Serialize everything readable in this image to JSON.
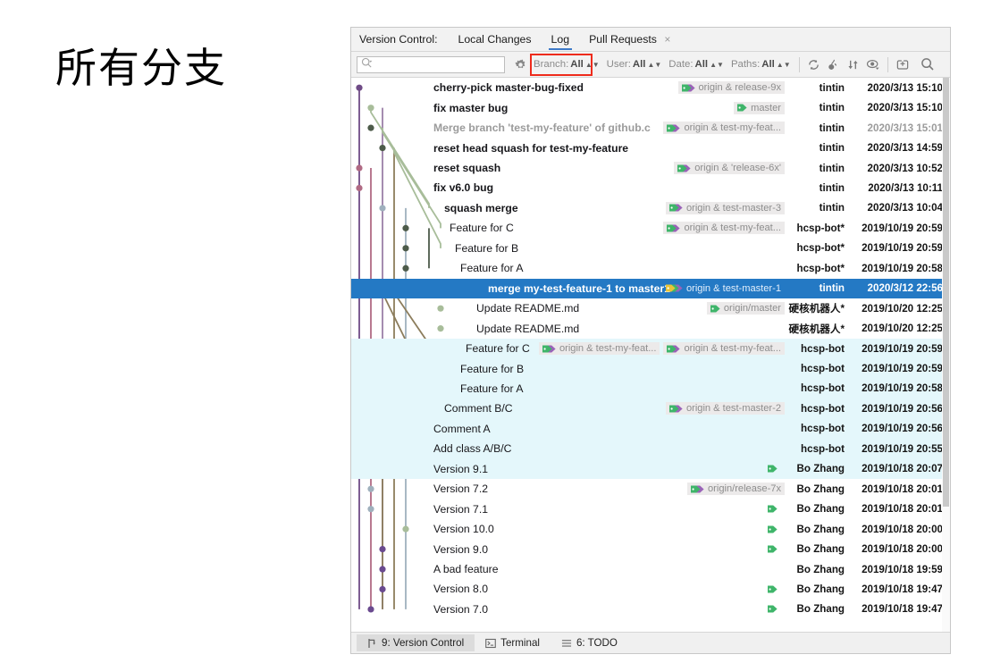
{
  "caption": "所有分支",
  "window": {
    "vc_label": "Version Control:",
    "tabs": [
      {
        "label": "Local Changes",
        "active": false,
        "closable": false
      },
      {
        "label": "Log",
        "active": true,
        "closable": false
      },
      {
        "label": "Pull Requests",
        "active": false,
        "closable": true
      }
    ],
    "close_glyph": "×"
  },
  "toolbar": {
    "search_placeholder": "",
    "search_icon": "search-icon",
    "settings_icon": "gear-icon",
    "filters": [
      {
        "name": "branch",
        "label": "Branch:",
        "value": "All",
        "highlighted": true
      },
      {
        "name": "user",
        "label": "User:",
        "value": "All",
        "highlighted": false
      },
      {
        "name": "date",
        "label": "Date:",
        "value": "All",
        "highlighted": false
      },
      {
        "name": "paths",
        "label": "Paths:",
        "value": "All",
        "highlighted": false
      }
    ],
    "icons": [
      {
        "name": "refresh-icon"
      },
      {
        "name": "cherry-pick-icon"
      },
      {
        "name": "sort-icon"
      },
      {
        "name": "show-details-icon"
      },
      {
        "name": "new-tab-icon"
      },
      {
        "name": "find-icon"
      }
    ],
    "highlight_color": "#ee2b1c"
  },
  "log": {
    "selected_index": 10,
    "band_start": 13,
    "band_end": 19,
    "rows": [
      {
        "subject": "cherry-pick master-bug-fixed",
        "indent": 92,
        "style": "bold",
        "refs": [
          {
            "text": "origin & release-9x",
            "icon": "double-tag-icon"
          }
        ],
        "author": "tintin",
        "date": "2020/3/13 15:10",
        "date_style": "normal"
      },
      {
        "subject": "fix master bug",
        "indent": 92,
        "style": "bold",
        "refs": [
          {
            "text": "master",
            "icon": "tag-icon"
          }
        ],
        "author": "tintin",
        "date": "2020/3/13 15:10",
        "date_style": "normal"
      },
      {
        "subject": "Merge branch 'test-my-feature' of github.c",
        "indent": 92,
        "style": "grey",
        "refs": [
          {
            "text": "origin & test-my-feat...",
            "icon": "double-tag-icon"
          }
        ],
        "author": "tintin",
        "date": "2020/3/13 15:01",
        "date_style": "grey"
      },
      {
        "subject": "reset head squash for test-my-feature",
        "indent": 92,
        "style": "bold",
        "refs": [],
        "author": "tintin",
        "date": "2020/3/13 14:59",
        "date_style": "normal"
      },
      {
        "subject": "reset squash",
        "indent": 92,
        "style": "bold",
        "refs": [
          {
            "text": "origin & 'release-6x'",
            "icon": "double-tag-icon"
          }
        ],
        "author": "tintin",
        "date": "2020/3/13 10:52",
        "date_style": "normal"
      },
      {
        "subject": "fix v6.0 bug",
        "indent": 92,
        "style": "bold",
        "refs": [],
        "author": "tintin",
        "date": "2020/3/13 10:11",
        "date_style": "normal"
      },
      {
        "subject": "squash merge",
        "indent": 104,
        "style": "bold",
        "refs": [
          {
            "text": "origin & test-master-3",
            "icon": "double-tag-icon"
          }
        ],
        "author": "tintin",
        "date": "2020/3/13 10:04",
        "date_style": "normal"
      },
      {
        "subject": "Feature for C",
        "indent": 110,
        "style": "normal",
        "refs": [
          {
            "text": "origin & test-my-feat...",
            "icon": "double-tag-icon"
          }
        ],
        "author": "hcsp-bot*",
        "date": "2019/10/19 20:59",
        "date_style": "normal"
      },
      {
        "subject": "Feature for B",
        "indent": 116,
        "style": "normal",
        "refs": [],
        "author": "hcsp-bot*",
        "date": "2019/10/19 20:59",
        "date_style": "normal"
      },
      {
        "subject": "Feature for A",
        "indent": 122,
        "style": "normal",
        "refs": [],
        "author": "hcsp-bot*",
        "date": "2019/10/19 20:58",
        "date_style": "normal"
      },
      {
        "subject": "merge my-test-feature-1 to master1",
        "indent": 153,
        "style": "bold",
        "refs": [
          {
            "text": "origin & test-master-1",
            "icon": "triple-tag-icon"
          }
        ],
        "author": "tintin",
        "date": "2020/3/12 22:56",
        "date_style": "normal"
      },
      {
        "subject": "Update README.md",
        "indent": 140,
        "style": "normal",
        "refs": [
          {
            "text": "origin/master",
            "icon": "tag-icon"
          }
        ],
        "author": "硬核机器人*",
        "date": "2019/10/20 12:25",
        "date_style": "normal"
      },
      {
        "subject": "Update README.md",
        "indent": 140,
        "style": "normal",
        "refs": [],
        "author": "硬核机器人*",
        "date": "2019/10/20 12:25",
        "date_style": "normal"
      },
      {
        "subject": "Feature for C",
        "indent": 128,
        "style": "normal",
        "refs": [
          {
            "text": "origin & test-my-feat...",
            "icon": "double-tag-icon"
          },
          {
            "text": "origin & test-my-feat...",
            "icon": "double-tag-icon"
          }
        ],
        "author": "hcsp-bot",
        "date": "2019/10/19 20:59",
        "date_style": "normal"
      },
      {
        "subject": "Feature for B",
        "indent": 122,
        "style": "normal",
        "refs": [],
        "author": "hcsp-bot",
        "date": "2019/10/19 20:59",
        "date_style": "normal"
      },
      {
        "subject": "Feature for A",
        "indent": 122,
        "style": "normal",
        "refs": [],
        "author": "hcsp-bot",
        "date": "2019/10/19 20:58",
        "date_style": "normal"
      },
      {
        "subject": "Comment B/C",
        "indent": 104,
        "style": "normal",
        "refs": [
          {
            "text": "origin & test-master-2",
            "icon": "double-tag-icon"
          }
        ],
        "author": "hcsp-bot",
        "date": "2019/10/19 20:56",
        "date_style": "normal"
      },
      {
        "subject": "Comment A",
        "indent": 92,
        "style": "normal",
        "refs": [],
        "author": "hcsp-bot",
        "date": "2019/10/19 20:56",
        "date_style": "normal"
      },
      {
        "subject": "Add class A/B/C",
        "indent": 92,
        "style": "normal",
        "refs": [],
        "author": "hcsp-bot",
        "date": "2019/10/19 20:55",
        "date_style": "normal"
      },
      {
        "subject": "Version 9.1",
        "indent": 92,
        "style": "normal",
        "refs": [
          {
            "text": "",
            "icon": "tag-icon"
          }
        ],
        "author": "Bo Zhang",
        "date": "2019/10/18 20:07",
        "date_style": "normal"
      },
      {
        "subject": "Version 7.2",
        "indent": 92,
        "style": "normal",
        "refs": [
          {
            "text": "origin/release-7x",
            "icon": "double-tag-icon"
          }
        ],
        "author": "Bo Zhang",
        "date": "2019/10/18 20:01",
        "date_style": "normal"
      },
      {
        "subject": "Version 7.1",
        "indent": 92,
        "style": "normal",
        "refs": [
          {
            "text": "",
            "icon": "tag-icon"
          }
        ],
        "author": "Bo Zhang",
        "date": "2019/10/18 20:01",
        "date_style": "normal"
      },
      {
        "subject": "Version 10.0",
        "indent": 92,
        "style": "normal",
        "refs": [
          {
            "text": "",
            "icon": "tag-icon"
          }
        ],
        "author": "Bo Zhang",
        "date": "2019/10/18 20:00",
        "date_style": "normal"
      },
      {
        "subject": "Version 9.0",
        "indent": 92,
        "style": "normal",
        "refs": [
          {
            "text": "",
            "icon": "tag-icon"
          }
        ],
        "author": "Bo Zhang",
        "date": "2019/10/18 20:00",
        "date_style": "normal"
      },
      {
        "subject": "A bad feature",
        "indent": 92,
        "style": "normal",
        "refs": [],
        "author": "Bo Zhang",
        "date": "2019/10/18 19:59",
        "date_style": "normal"
      },
      {
        "subject": "Version 8.0",
        "indent": 92,
        "style": "normal",
        "refs": [
          {
            "text": "",
            "icon": "tag-icon"
          }
        ],
        "author": "Bo Zhang",
        "date": "2019/10/18 19:47",
        "date_style": "normal"
      },
      {
        "subject": "Version 7.0",
        "indent": 92,
        "style": "normal",
        "refs": [
          {
            "text": "",
            "icon": "tag-icon"
          }
        ],
        "author": "Bo Zhang",
        "date": "2019/10/18 19:47",
        "date_style": "normal"
      }
    ]
  },
  "statusbar": {
    "items": [
      {
        "label": "9: Version Control",
        "shortcut": "9",
        "icon": "branch-icon",
        "active": true
      },
      {
        "label": "Terminal",
        "shortcut": "",
        "icon": "terminal-icon",
        "active": false
      },
      {
        "label": "6: TODO",
        "shortcut": "6",
        "icon": "list-icon",
        "active": false
      }
    ]
  },
  "colors": {
    "selection": "#2479c4",
    "band": "#e4f7fb",
    "accent_red": "#ee2b1c",
    "lanes": [
      "#6f4b86",
      "#b06a84",
      "#9b7fa8",
      "#8c7d5c",
      "#a8bd9a",
      "#9fb0bd",
      "#4d5b4a",
      "#b08a4a"
    ]
  }
}
